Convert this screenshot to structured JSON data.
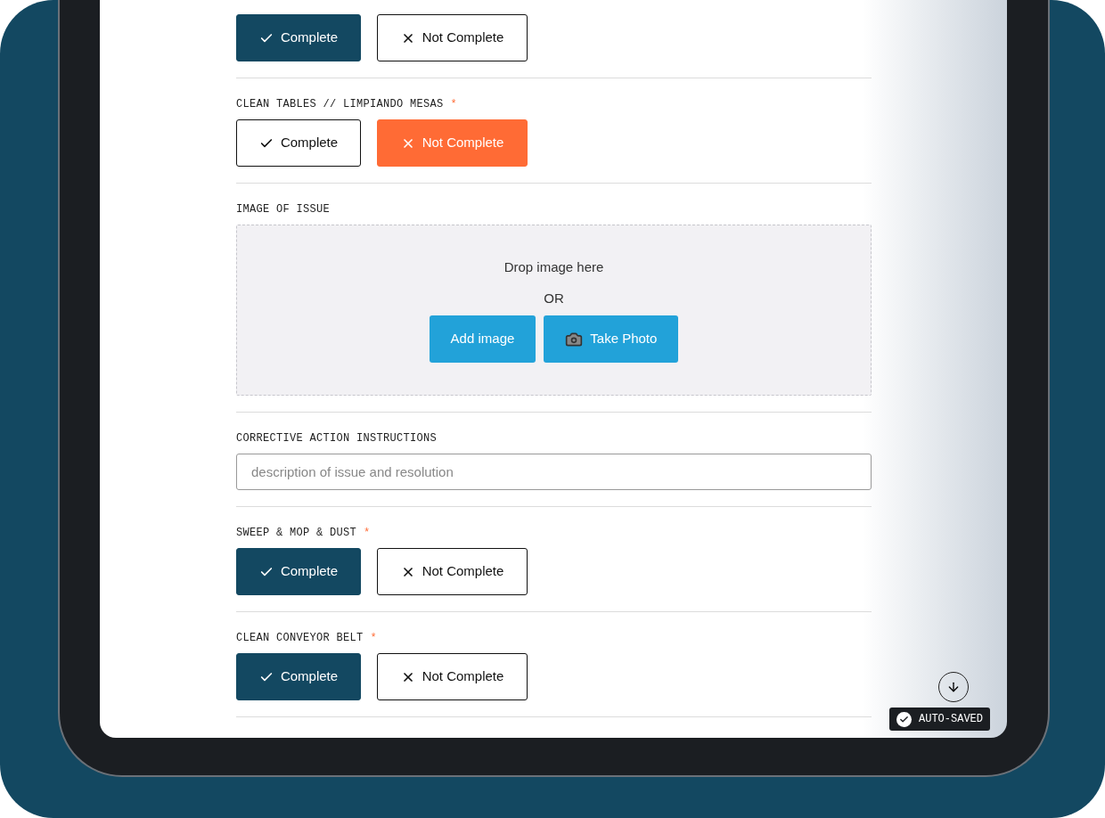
{
  "sections": [
    {
      "kind": "choice",
      "options": [
        {
          "label": "Complete",
          "selected": true
        },
        {
          "label": "Not Complete",
          "selected": false
        }
      ]
    },
    {
      "kind": "choice",
      "label": "CLEAN TABLES // LIMPIANDO MESAS",
      "required_mark": "*",
      "options": [
        {
          "label": "Complete",
          "selected": false
        },
        {
          "label": "Not Complete",
          "selected": true
        }
      ]
    },
    {
      "kind": "upload",
      "label": "IMAGE OF ISSUE",
      "drop_text": "Drop image here",
      "or_text": "OR",
      "buttons": [
        {
          "label": "Add image"
        },
        {
          "label": "Take Photo"
        }
      ]
    },
    {
      "kind": "text",
      "label": "CORRECTIVE ACTION INSTRUCTIONS",
      "placeholder": "description of issue and resolution"
    },
    {
      "kind": "choice",
      "label": "SWEEP & MOP & DUST",
      "required_mark": "*",
      "options": [
        {
          "label": "Complete",
          "selected": true
        },
        {
          "label": "Not Complete",
          "selected": false
        }
      ]
    },
    {
      "kind": "choice",
      "label": "CLEAN CONVEYOR BELT",
      "required_mark": "*",
      "options": [
        {
          "label": "Complete",
          "selected": true
        },
        {
          "label": "Not Complete",
          "selected": false
        }
      ]
    }
  ],
  "status": {
    "text": "AUTO-SAVED"
  }
}
